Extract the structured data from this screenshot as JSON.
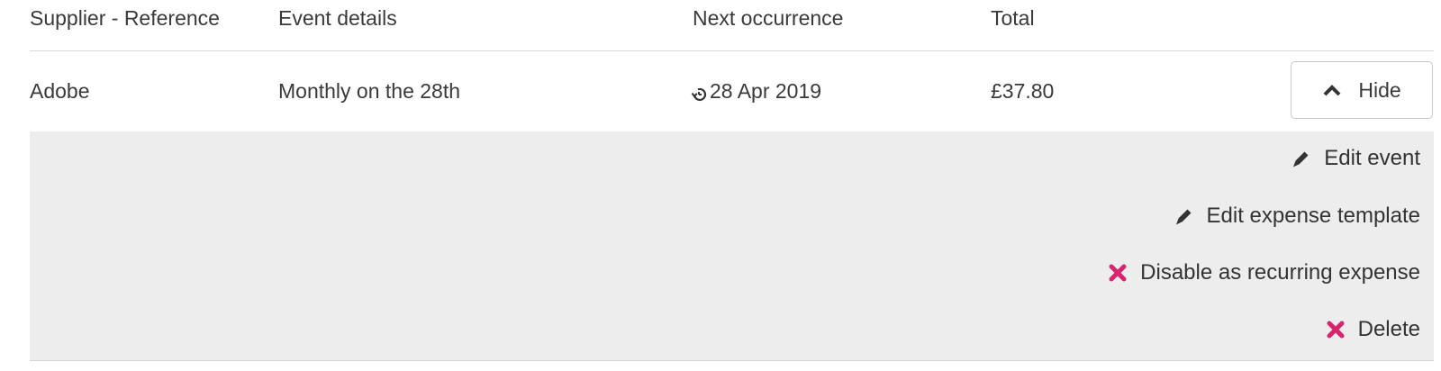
{
  "table": {
    "headers": {
      "supplier": "Supplier - Reference",
      "event": "Event details",
      "next": "Next occurrence",
      "total": "Total"
    },
    "row": {
      "supplier": "Adobe",
      "event": "Monthly on the 28th",
      "next": "28 Apr 2019",
      "total": "£37.80",
      "toggle_label": "Hide"
    }
  },
  "actions": {
    "edit_event": "Edit event",
    "edit_template": "Edit expense template",
    "disable": "Disable as recurring expense",
    "delete": "Delete"
  },
  "icons": {
    "recurring": "recurring-icon",
    "chevron": "chevron-up-icon",
    "edit": "pencil-icon",
    "remove": "cross-icon"
  },
  "colors": {
    "danger": "#d6246e",
    "panel_bg": "#ededed",
    "icon_dark": "#333333"
  }
}
